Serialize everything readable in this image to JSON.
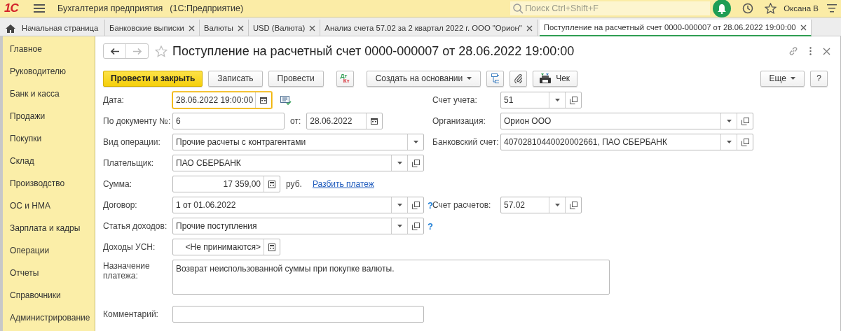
{
  "app": {
    "logo": "1С",
    "title": "Бухгалтерия предприятия",
    "subtitle": "(1С:Предприятие)",
    "search": {
      "placeholder": "Поиск Ctrl+Shift+F"
    },
    "user": "Оксана В"
  },
  "tabs": [
    {
      "label": "Начальная страница",
      "kind": "home",
      "selected": false
    },
    {
      "label": "Банковские выписки",
      "kind": "tab",
      "selected": false
    },
    {
      "label": "Валюты",
      "kind": "tab",
      "selected": false
    },
    {
      "label": "USD (Валюта)",
      "kind": "tab",
      "selected": false
    },
    {
      "label": "Анализ счета 57.02 за 2 квартал 2022 г. ООО \"Орион\"",
      "kind": "tab",
      "selected": false
    },
    {
      "label": "Поступление на расчетный счет 0000-000007 от 28.06.2022 19:00:00",
      "kind": "tab",
      "selected": true
    }
  ],
  "sidebar": {
    "items": [
      "Главное",
      "Руководителю",
      "Банк и касса",
      "Продажи",
      "Покупки",
      "Склад",
      "Производство",
      "ОС и НМА",
      "Зарплата и кадры",
      "Операции",
      "Отчеты",
      "Справочники",
      "Администрирование"
    ]
  },
  "document": {
    "title": "Поступление на расчетный счет 0000-000007 от 28.06.2022 19:00:00",
    "toolbar": [
      {
        "kind": "primary",
        "label": "Провести и закрыть"
      },
      {
        "kind": "button",
        "label": "Записать"
      },
      {
        "kind": "button",
        "label": "Провести"
      },
      {
        "kind": "dtkt",
        "top": "Дт",
        "bottom": "Кт"
      },
      {
        "kind": "dropdown",
        "label": "Создать на основании"
      },
      {
        "kind": "structure"
      },
      {
        "kind": "attach"
      },
      {
        "kind": "receipt",
        "label": "Чек"
      }
    ],
    "toolbar_right": [
      {
        "kind": "dropdown",
        "label": "Еще"
      },
      {
        "kind": "button",
        "label": "?"
      }
    ],
    "rows": [
      {
        "left": [
          {
            "kind": "date",
            "label": "Дата:",
            "value": "28.06.2022 19:00:00",
            "focused": true
          },
          {
            "kind": "journal"
          }
        ],
        "right": [
          {
            "kind": "select_open",
            "label": "Счет учета:",
            "value": "51"
          }
        ]
      },
      {
        "left": [
          {
            "kind": "text",
            "label": "По документу №:",
            "value": "6"
          },
          {
            "kind": "date",
            "label": "от:",
            "value": "28.06.2022"
          }
        ],
        "right": [
          {
            "kind": "select_open",
            "label": "Организация:",
            "value": "Орион ООО"
          }
        ]
      },
      {
        "left": [
          {
            "kind": "select",
            "label": "Вид операции:",
            "value": "Прочие расчеты с контрагентами"
          }
        ],
        "right": [
          {
            "kind": "select_open",
            "label": "Банковский счет:",
            "value": "40702810440020002661, ПАО СБЕРБАНК"
          }
        ]
      },
      {
        "left": [
          {
            "kind": "select_open",
            "label": "Плательщик:",
            "value": "ПАО СБЕРБАНК"
          }
        ]
      },
      {
        "left": [
          {
            "kind": "number",
            "label": "Сумма:",
            "value": "17 359,00"
          },
          {
            "kind": "unit",
            "text": "руб."
          },
          {
            "kind": "link",
            "text": "Разбить платеж"
          }
        ]
      },
      {
        "left": [
          {
            "kind": "select_open",
            "label": "Договор:",
            "value": "1 от 01.06.2022"
          },
          {
            "kind": "help",
            "text": "?"
          }
        ],
        "right": [
          {
            "kind": "select_open",
            "label": "Счет расчетов:",
            "value": "57.02"
          }
        ]
      },
      {
        "left": [
          {
            "kind": "select_open",
            "label": "Статья доходов:",
            "value": "Прочие поступления"
          },
          {
            "kind": "help",
            "text": "?"
          }
        ]
      },
      {
        "left": [
          {
            "kind": "number",
            "label": "Доходы УСН:",
            "value": "<Не принимаются>"
          }
        ]
      },
      {
        "left": [
          {
            "kind": "textarea",
            "label": "Назначение платежа:",
            "value": "Возврат неиспользованной суммы при покупке валюты."
          }
        ]
      },
      {
        "left": [
          {
            "kind": "text",
            "label": "Комментарий:"
          }
        ]
      }
    ]
  }
}
